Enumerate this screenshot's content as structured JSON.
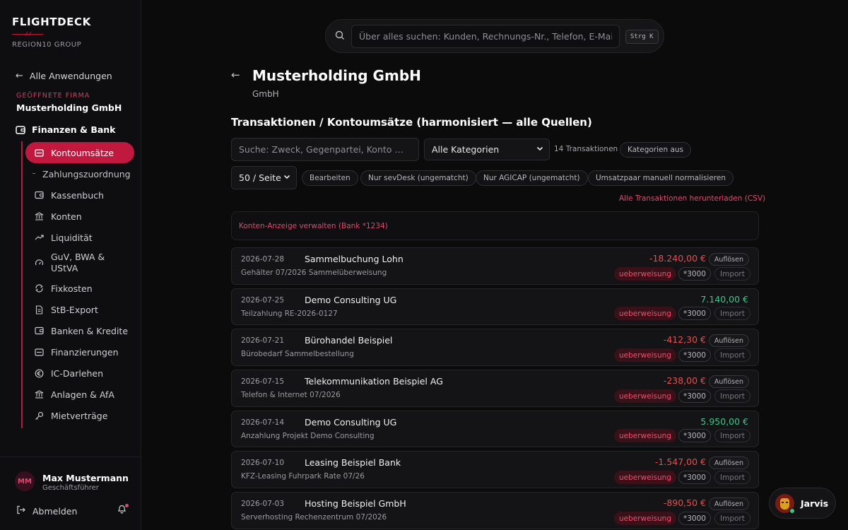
{
  "brand": {
    "name": "FLIGHTDECK",
    "group": "REGION10 GROUP"
  },
  "sidebar": {
    "back_label": "Alle Anwendungen",
    "opened_label": "GEÖFFNETE FIRMA",
    "opened_company": "Musterholding GmbH",
    "section_label": "Finanzen & Bank",
    "items": [
      {
        "label": "Kontoumsätze",
        "icon": "card-icon"
      },
      {
        "label": "Zahlungszuordnung",
        "icon": ""
      },
      {
        "label": "Kassenbuch",
        "icon": "wallet-icon"
      },
      {
        "label": "Konten",
        "icon": "bank-icon"
      },
      {
        "label": "Liquidität",
        "icon": "trend-icon"
      },
      {
        "label": "GuV, BWA & USt­VA",
        "icon": "gauge-icon"
      },
      {
        "label": "Fixkosten",
        "icon": "repeat-icon"
      },
      {
        "label": "StB-Export",
        "icon": "document-icon"
      },
      {
        "label": "Banken & Kredite",
        "icon": "wallet-icon"
      },
      {
        "label": "Finanzierungen",
        "icon": "card-icon"
      },
      {
        "label": "IC-Darlehen",
        "icon": "euro-icon"
      },
      {
        "label": "Anlagen & AfA",
        "icon": "bank-icon"
      },
      {
        "label": "Mietverträge",
        "icon": "key-icon"
      }
    ],
    "user": {
      "initials": "MM",
      "name": "Max Mustermann",
      "role": "Geschäftsführer"
    },
    "logout_label": "Abmelden"
  },
  "search": {
    "placeholder": "Über alles suchen: Kunden, Rechnungs-Nr., Telefon, E-Mail, Mail-Betreff …",
    "shortcut": "Strg K"
  },
  "page": {
    "title": "Musterholding GmbH",
    "subtitle": "GmbH",
    "section_title": "Transaktionen / Kontoumsätze (harmonisiert — alle Quellen)"
  },
  "filters": {
    "search_placeholder": "Suche: Zweck, Gegenpartei, Konto …",
    "category_select": "Alle Kategorien",
    "count_text": "14 Transaktionen",
    "categories_toggle": "Kategorien aus",
    "page_size": "50 / Seite",
    "buttons": {
      "edit": "Bearbeiten",
      "sevdesk": "Nur sevDesk (ungematcht)",
      "agicap": "Nur AGICAP (ungematcht)",
      "normalize": "Umsatzpaar manuell normalisieren"
    },
    "csv_link": "Alle Transaktionen herunterladen (CSV)",
    "accounts_link": "Konten-Anzeige verwalten (Bank *1234)"
  },
  "transactions": [
    {
      "date": "2026-07-28",
      "party": "Sammelbuchung Lohn",
      "purpose": "Gehälter 07/2026 Sammelüberweisung",
      "amount": "-18.240,00 €",
      "negative": true,
      "type": "ueberweisung",
      "account": "*3000",
      "resolve": "Auflösen",
      "import": "Import"
    },
    {
      "date": "2026-07-25",
      "party": "Demo Consulting UG",
      "purpose": "Teilzahlung RE-2026-0127",
      "amount": "7.140,00 €",
      "negative": false,
      "type": "ueberweisung",
      "account": "*3000",
      "resolve": "",
      "import": "Import"
    },
    {
      "date": "2026-07-21",
      "party": "Bürohandel Beispiel",
      "purpose": "Bürobedarf Sammelbestellung",
      "amount": "-412,30 €",
      "negative": true,
      "type": "ueberweisung",
      "account": "*3000",
      "resolve": "Auflösen",
      "import": "Import"
    },
    {
      "date": "2026-07-15",
      "party": "Telekommunikation Beispiel AG",
      "purpose": "Telefon & Internet 07/2026",
      "amount": "-238,00 €",
      "negative": true,
      "type": "ueberweisung",
      "account": "*3000",
      "resolve": "Auflösen",
      "import": "Import"
    },
    {
      "date": "2026-07-14",
      "party": "Demo Consulting UG",
      "purpose": "Anzahlung Projekt Demo Consulting",
      "amount": "5.950,00 €",
      "negative": false,
      "type": "ueberweisung",
      "account": "*3000",
      "resolve": "",
      "import": "Import"
    },
    {
      "date": "2026-07-10",
      "party": "Leasing Beispiel Bank",
      "purpose": "KFZ-Leasing Fuhrpark Rate 07/26",
      "amount": "-1.547,00 €",
      "negative": true,
      "type": "ueberweisung",
      "account": "*3000",
      "resolve": "Auflösen",
      "import": "Import"
    },
    {
      "date": "2026-07-03",
      "party": "Hosting Beispiel GmbH",
      "purpose": "Serverhosting Rechenzentrum 07/2026",
      "amount": "-890,50 €",
      "negative": true,
      "type": "ueberweisung",
      "account": "*3000",
      "resolve": "Auflösen",
      "import": "Import"
    }
  ],
  "assistant": {
    "name": "Jarvis"
  },
  "colors": {
    "accent": "#c0183f",
    "negative": "#f24a4a",
    "positive": "#2ecc8a",
    "link": "#e0476f"
  }
}
